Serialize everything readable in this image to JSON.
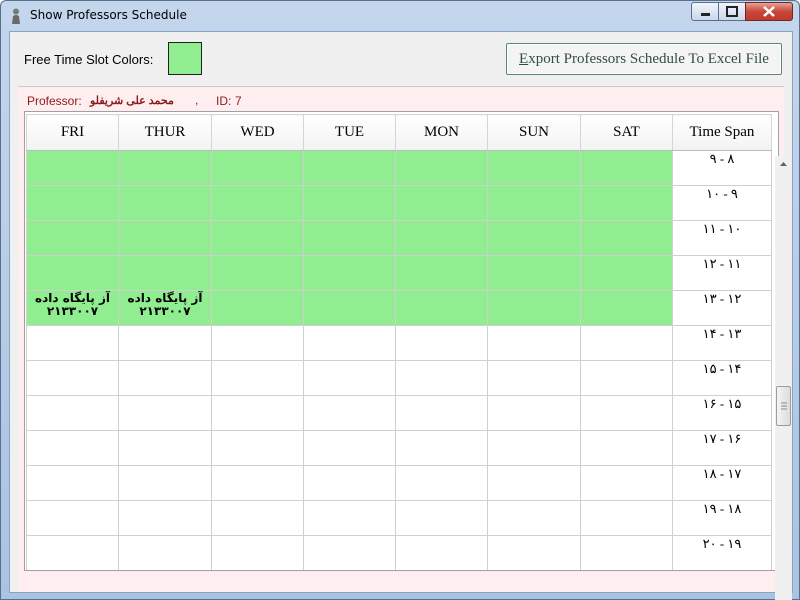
{
  "window": {
    "title": "Show Professors Schedule",
    "icon": "person-icon"
  },
  "toolbar": {
    "free_label": "Free Time Slot Colors:",
    "free_color": "#90ee90",
    "export_mnemonic": "E",
    "export_rest": "xport Professors Schedule To Excel File"
  },
  "professor": {
    "label": "Professor:",
    "name": "محمد علی شریفلو",
    "separator": ",",
    "id_label": "ID:",
    "id_value": "7"
  },
  "table": {
    "headers": [
      "FRI",
      "THUR",
      "WED",
      "TUE",
      "MON",
      "SUN",
      "SAT",
      "Time Span"
    ],
    "rows": [
      {
        "time": "۹ - ۸",
        "cells": [
          "free",
          "free",
          "free",
          "free",
          "free",
          "free",
          "free"
        ]
      },
      {
        "time": "۱۰ - ۹",
        "cells": [
          "free",
          "free",
          "free",
          "free",
          "free",
          "free",
          "free"
        ]
      },
      {
        "time": "۱۱ - ۱۰",
        "cells": [
          "free",
          "free",
          "free",
          "free",
          "free",
          "free",
          "free"
        ]
      },
      {
        "time": "۱۲ - ۱۱",
        "cells": [
          "free",
          "free",
          "free",
          "free",
          "free",
          "free",
          "free"
        ]
      },
      {
        "time": "۱۳ - ۱۲",
        "cells": [
          "course",
          "course",
          "free",
          "free",
          "free",
          "free",
          "free"
        ]
      },
      {
        "time": "۱۴ - ۱۳",
        "cells": [
          "busy",
          "busy",
          "busy",
          "busy",
          "busy",
          "busy",
          "busy"
        ]
      },
      {
        "time": "۱۵ - ۱۴",
        "cells": [
          "busy",
          "busy",
          "busy",
          "busy",
          "busy",
          "busy",
          "busy"
        ]
      },
      {
        "time": "۱۶ - ۱۵",
        "cells": [
          "busy",
          "busy",
          "busy",
          "busy",
          "busy",
          "busy",
          "busy"
        ]
      },
      {
        "time": "۱۷ - ۱۶",
        "cells": [
          "busy",
          "busy",
          "busy",
          "busy",
          "busy",
          "busy",
          "busy"
        ]
      },
      {
        "time": "۱۸ - ۱۷",
        "cells": [
          "busy",
          "busy",
          "busy",
          "busy",
          "busy",
          "busy",
          "busy"
        ]
      },
      {
        "time": "۱۹ - ۱۸",
        "cells": [
          "busy",
          "busy",
          "busy",
          "busy",
          "busy",
          "busy",
          "busy"
        ]
      },
      {
        "time": "۲۰ - ۱۹",
        "cells": [
          "busy",
          "busy",
          "busy",
          "busy",
          "busy",
          "busy",
          "busy"
        ]
      }
    ],
    "course_cells": [
      {
        "line1": "آز پایگاه داده",
        "line2": "۲۱۳۳۰۰۷"
      },
      {
        "line1": "آز پایگاه داده",
        "line2": "۲۱۳۳۰۰۷"
      }
    ]
  }
}
